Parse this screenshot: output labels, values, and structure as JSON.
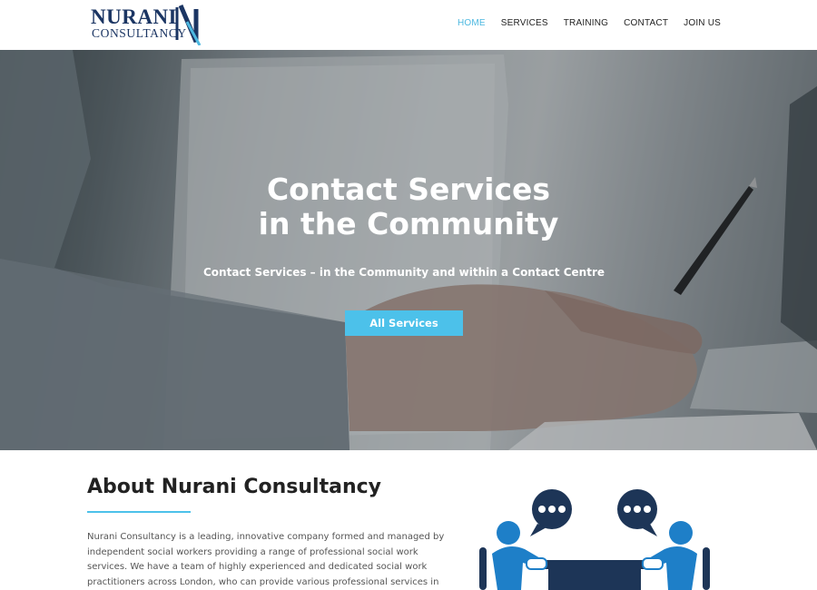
{
  "brand": {
    "name": "NURANI",
    "tagline": "CONSULTANCY",
    "color": "#1b3563"
  },
  "nav": {
    "items": [
      {
        "label": "HOME",
        "active": true
      },
      {
        "label": "SERVICES",
        "active": false
      },
      {
        "label": "TRAINING",
        "active": false
      },
      {
        "label": "CONTACT",
        "active": false
      },
      {
        "label": "JOIN US",
        "active": false
      }
    ],
    "active_color": "#4cb8e0"
  },
  "hero": {
    "title_line1": "Contact Services",
    "title_line2": "in the Community",
    "subtitle": "Contact Services – in the Community and within a Contact Centre",
    "button_label": "All Services",
    "button_color": "#4cc1ea"
  },
  "about": {
    "title": "About Nurani Consultancy",
    "text": "Nurani Consultancy is a leading, innovative company formed and managed by independent social workers providing a range of professional social work services. We have a team of highly experienced and dedicated social work practitioners across London, who can provide various professional services in the field of family law, child",
    "accent_color": "#4cc1ea",
    "illustration": "meeting-icon"
  }
}
